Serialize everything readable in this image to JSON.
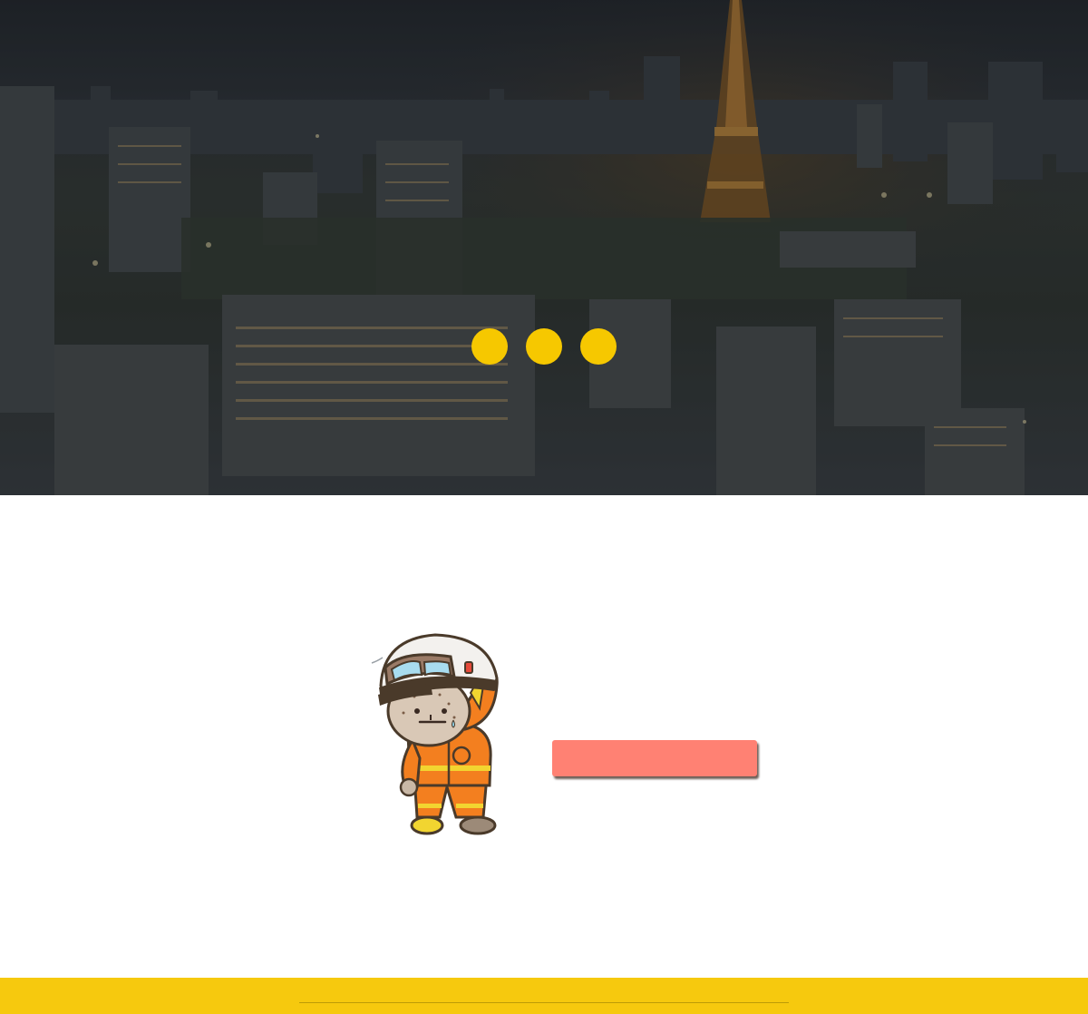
{
  "hero": {
    "background_image": "night-city-skyline-with-tower",
    "loader_dot_color": "#f6c800"
  },
  "main": {
    "mascot_image": "firefighter-mascot-wiping-sweat",
    "action_button": {
      "label": "",
      "color": "#ff8173"
    }
  },
  "footer": {
    "background_color": "#f6c90e"
  }
}
